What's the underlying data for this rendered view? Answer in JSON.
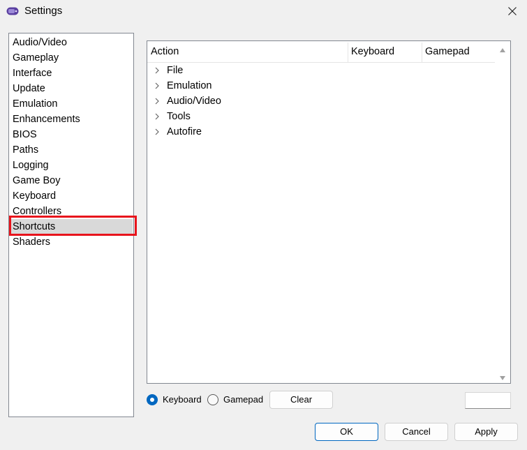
{
  "window": {
    "title": "Settings",
    "icon": "mgba-app-icon",
    "close_icon": "close-icon"
  },
  "nav": {
    "items": [
      {
        "label": "Audio/Video"
      },
      {
        "label": "Gameplay"
      },
      {
        "label": "Interface"
      },
      {
        "label": "Update"
      },
      {
        "label": "Emulation"
      },
      {
        "label": "Enhancements"
      },
      {
        "label": "BIOS"
      },
      {
        "label": "Paths"
      },
      {
        "label": "Logging"
      },
      {
        "label": "Game Boy"
      },
      {
        "label": "Keyboard"
      },
      {
        "label": "Controllers"
      },
      {
        "label": "Shortcuts"
      },
      {
        "label": "Shaders"
      }
    ],
    "selected": "Shortcuts",
    "highlight_color": "#e8141c"
  },
  "shortcuts": {
    "columns": [
      "Action",
      "Keyboard",
      "Gamepad"
    ],
    "rows": [
      {
        "label": "File"
      },
      {
        "label": "Emulation"
      },
      {
        "label": "Audio/Video"
      },
      {
        "label": "Tools"
      },
      {
        "label": "Autofire"
      }
    ],
    "mode_options": {
      "keyboard": "Keyboard",
      "gamepad": "Gamepad"
    },
    "mode_selected": "Keyboard",
    "clear_label": "Clear",
    "binding_value": ""
  },
  "footer": {
    "ok_label": "OK",
    "cancel_label": "Cancel",
    "apply_label": "Apply"
  },
  "colors": {
    "accent": "#0067c0",
    "selection": "#d9d9d9"
  }
}
